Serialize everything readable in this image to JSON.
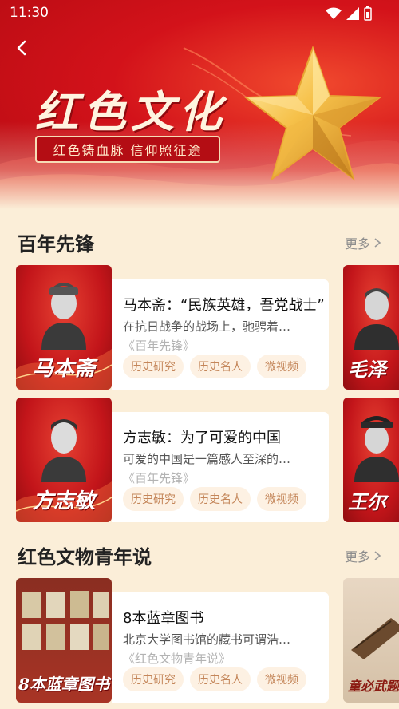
{
  "status_bar": {
    "time": "11:30"
  },
  "banner": {
    "title": "红色文化",
    "subtitle": "红色铸血脉 信仰照征途",
    "colors": {
      "red": "#d3121a",
      "gold": "#f4b63a"
    }
  },
  "sections": [
    {
      "title": "百年先锋",
      "more_label": "更多",
      "cards": [
        {
          "thumb_name": "马本斋",
          "title": "马本斋：“民族英雄，吾党战士”",
          "desc": "在抗日战争的战场上，驰骋着…",
          "source": "《百年先锋》",
          "tags": [
            "历史研究",
            "历史名人",
            "微视频"
          ],
          "peek_name": "毛泽"
        },
        {
          "thumb_name": "方志敏",
          "title": "方志敏：为了可爱的中国",
          "desc": "可爱的中国是一篇感人至深的…",
          "source": "《百年先锋》",
          "tags": [
            "历史研究",
            "历史名人",
            "微视频"
          ],
          "peek_name": "王尔"
        }
      ]
    },
    {
      "title": "红色文物青年说",
      "more_label": "更多",
      "cards": [
        {
          "thumb_name": "8本蓝章图书",
          "title": "8本蓝章图书",
          "desc": "北京大学图书馆的藏书可谓浩…",
          "source": "《红色文物青年说》",
          "tags": [
            "历史研究",
            "历史名人",
            "微视频"
          ],
          "peek_name": "童必武题"
        }
      ]
    }
  ],
  "icons": {
    "back": "chevron-left-icon",
    "more": "chevron-right-icon",
    "wifi": "wifi-icon",
    "signal": "signal-icon",
    "battery": "battery-icon"
  },
  "accent_tag_color": "#c4865a",
  "tag_bg_color": "#fdf1e3"
}
